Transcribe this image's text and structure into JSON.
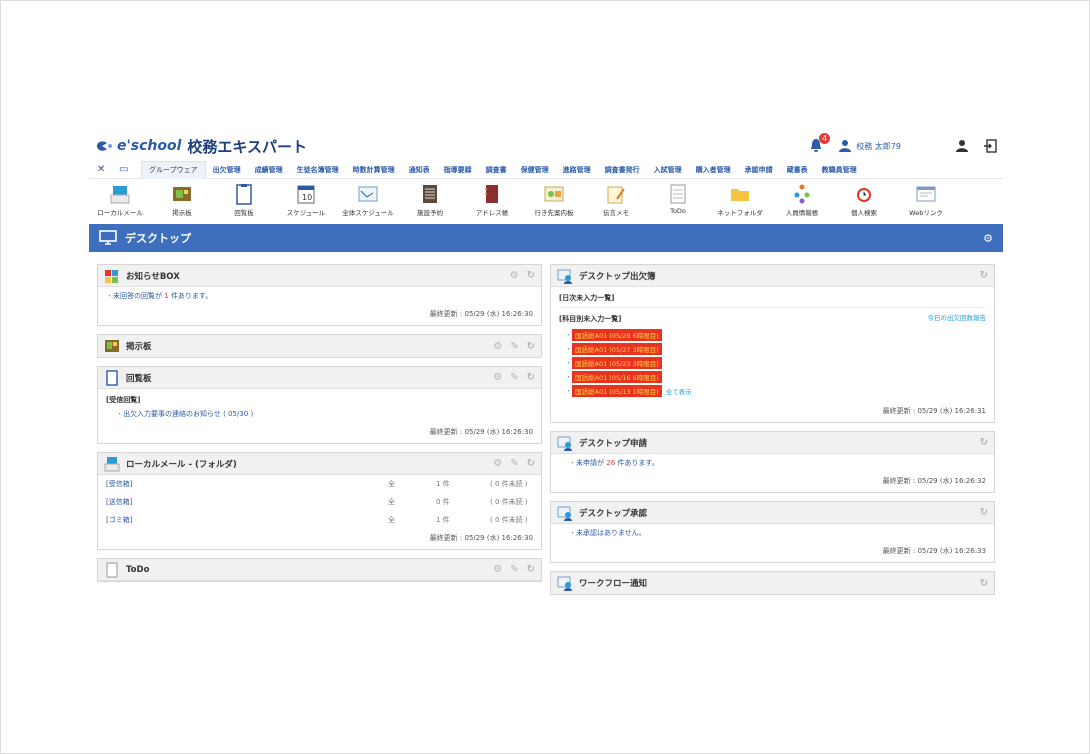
{
  "header": {
    "logo_text": "e'school",
    "app_title": "校務エキスパート",
    "notification_count": "4",
    "user_name": "校務 太郎79"
  },
  "menu": {
    "items": [
      "グループウェア",
      "出欠管理",
      "成績管理",
      "生徒名簿管理",
      "時数計算管理",
      "通知表",
      "指導要録",
      "調査書",
      "保健管理",
      "進路管理",
      "調査書発行",
      "入試管理",
      "購入者管理",
      "承認申請",
      "蔵書表",
      "教職員管理"
    ]
  },
  "toolbar": {
    "items": [
      "ローカルメール",
      "掲示板",
      "回覧板",
      "スケジュール",
      "全体スケジュール",
      "施設予約",
      "アドレス帳",
      "行き先案内板",
      "伝言メモ",
      "ToDo",
      "ネットフォルダ",
      "人員情報帳",
      "個人検索",
      "Webリンク"
    ]
  },
  "desktop": {
    "title": "デスクトップ"
  },
  "panels": {
    "notice": {
      "title": "お知らせBOX",
      "line_prefix": "未回答の回覧が",
      "count": "1",
      "line_suffix": "件あります。",
      "updated": "最終更新 : 05/29 (水) 16:26:30"
    },
    "board": {
      "title": "掲示板"
    },
    "circular": {
      "title": "回覧板",
      "section": "[受信回覧]",
      "item": "出欠入力要事の連絡のお知らせ ( 05/30 )",
      "updated": "最終更新 : 05/29 (水) 16:26:30"
    },
    "localmail": {
      "title": "ローカルメール - (フォルダ)",
      "rows": [
        {
          "folder": "[受信箱]",
          "mark": "全",
          "count": "1 件",
          "unread": "( 0 件未読 )"
        },
        {
          "folder": "[送信箱]",
          "mark": "全",
          "count": "0 件",
          "unread": "( 0 件未読 )"
        },
        {
          "folder": "[ゴミ箱]",
          "mark": "全",
          "count": "1 件",
          "unread": "( 0 件未読 )"
        }
      ],
      "updated": "最終更新 : 05/29 (水) 16:26:30"
    },
    "todo": {
      "title": "ToDo"
    },
    "attendance": {
      "title": "デスクトップ出欠簿",
      "section1": "[日次未入力一覧]",
      "section2": "[科目別未入力一覧]",
      "right_link": "今日の出欠回数報告",
      "items": [
        "国語総A01 (05/28 6時限目)",
        "国語総A01 (05/27 3時限目)",
        "国語総A01 (05/23 3時限目)",
        "国語総A01 (05/16 6時限目)",
        "国語総A01 (05/13 1時限目)"
      ],
      "more_link": "全て表示",
      "updated": "最終更新 : 05/29 (水) 16:26:31"
    },
    "request": {
      "title": "デスクトップ申請",
      "line_prefix": "未申請が",
      "count": "26",
      "line_suffix": "件あります。",
      "updated": "最終更新 : 05/29 (水) 16:26:32"
    },
    "approval": {
      "title": "デスクトップ承認",
      "line": "未承認はありません。",
      "updated": "最終更新 : 05/29 (水) 16:26:33"
    },
    "workflow": {
      "title": "ワークフロー通知"
    }
  },
  "colors": {
    "brand": "#3e6fbf",
    "alert_bg": "#e8341e",
    "alert_text": "#ffd34d"
  }
}
